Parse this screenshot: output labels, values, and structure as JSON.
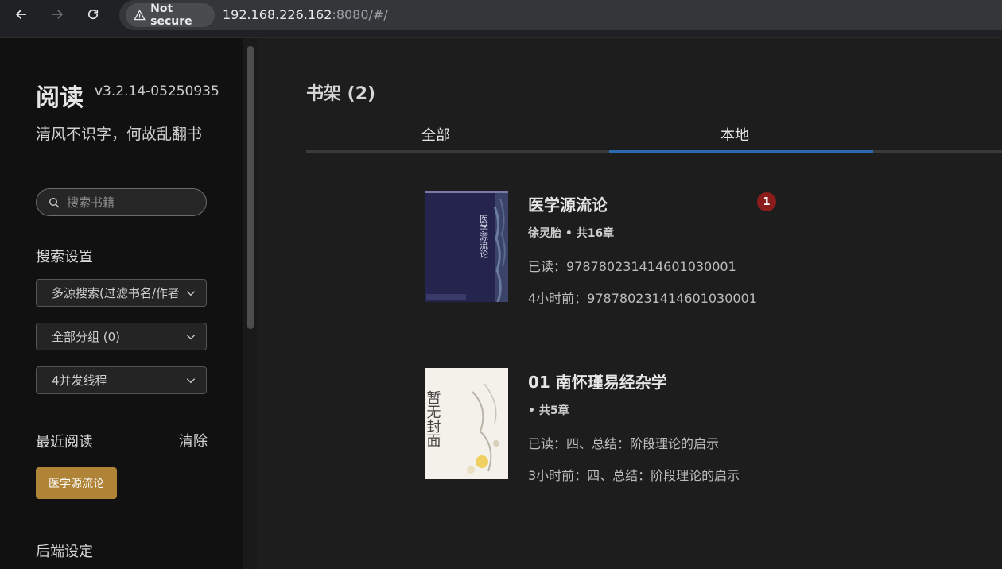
{
  "browser": {
    "security_label": "Not secure",
    "url_host": "192.168.226.162",
    "url_rest": ":8080/#/"
  },
  "sidebar": {
    "app_name": "阅读",
    "version": "v3.2.14-05250935",
    "motto": "清风不识字，何故乱翻书",
    "search_placeholder": "搜索书籍",
    "search_settings_label": "搜索设置",
    "selects": [
      {
        "value": "多源搜索(过滤书名/作者"
      },
      {
        "value": "全部分组 (0)"
      },
      {
        "value": "4并发线程"
      }
    ],
    "recent_label": "最近阅读",
    "clear_label": "清除",
    "recent_books": [
      "医学源流论"
    ],
    "backend_label": "后端设定"
  },
  "main": {
    "shelf_title": "书架 (2)",
    "tabs": [
      {
        "label": "全部"
      },
      {
        "label": "本地"
      }
    ],
    "books": [
      {
        "title": "医学源流论",
        "author": "徐灵胎",
        "chapters": "共16章",
        "read": "已读：978780231414601030001",
        "latest": "4小时前：978780231414601030001",
        "badge": "1",
        "cover_text": "医学源流论"
      },
      {
        "title": "01 南怀瑾易经杂学",
        "author": "",
        "chapters": "共5章",
        "read": "已读：四、总结：阶段理论的启示",
        "latest": "3小时前：四、总结：阶段理论的启示",
        "cover_text": "暂无封面"
      }
    ]
  },
  "colors": {
    "accent_tab": "#2b6cb0",
    "recent_chip": "#b08437",
    "badge": "#8a1c1c"
  }
}
